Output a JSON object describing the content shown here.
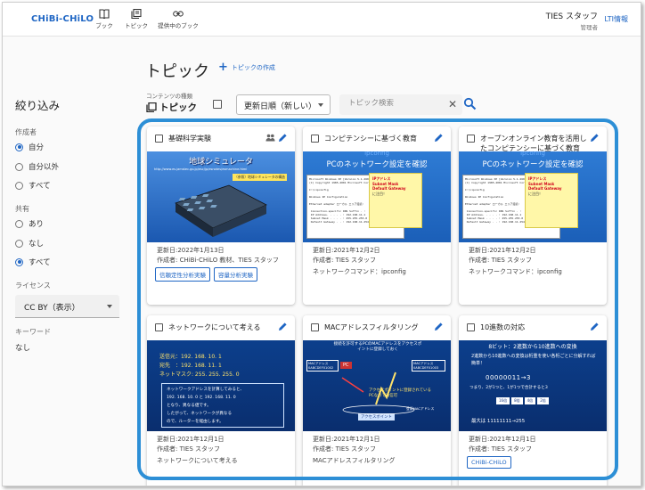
{
  "app": {
    "logo": "CHiBi-CHiLO",
    "nav": [
      {
        "label": "ブック",
        "icon": "book-icon"
      },
      {
        "label": "トピック",
        "icon": "topic-icon"
      },
      {
        "label": "提供中のブック",
        "icon": "link-icon"
      }
    ],
    "user_name": "TIES スタッフ",
    "user_role": "管理者",
    "lti_link": "LTI情報"
  },
  "sidebar": {
    "title": "絞り込み",
    "author_label": "作成者",
    "author_options": [
      "自分",
      "自分以外",
      "すべて"
    ],
    "author_selected": 0,
    "shared_label": "共有",
    "shared_options": [
      "あり",
      "なし",
      "すべて"
    ],
    "shared_selected": 2,
    "license_label": "ライセンス",
    "license_value": "CC BY（表示）",
    "keyword_label": "キーワード",
    "keyword_value": "なし"
  },
  "main": {
    "title": "トピック",
    "add_link": "トピックの作成",
    "content_type_label": "コンテンツの種類",
    "content_type": "トピック",
    "sort_value": "更新日順（新しい）",
    "search_placeholder": "トピック検索"
  },
  "cards": [
    {
      "title": "基礎科学実験",
      "thumb_title": "地球シミュレータ",
      "thumb_url": "http://www.es.jamstec.go.jp/esc/jp/esnotes/esmachine.html",
      "thumb_note": "（参照）地球シミュレータの構造",
      "updated": "更新日:2022年1月13日",
      "author": "作成者: CHiBi-CHiLO 教材、TIES スタッフ",
      "tags": [
        "信頼定性分析実験",
        "容量分析実験"
      ],
      "shared": true
    },
    {
      "title": "コンピテンシーに基づく教育",
      "thumb_title": "PCのネットワーク設定を確認",
      "thumb_over": "ipconfig",
      "updated": "更新日:2021年12月2日",
      "author": "作成者: TIES スタッフ",
      "keyword": "ネットワークコマンド：ipconfig",
      "yellow_red": [
        "IPアドレス",
        "Subnet Mask",
        "Default Gateway"
      ],
      "yellow_text": "に注目！"
    },
    {
      "title": "オープンオンライン教育を活用したコンピテンシーに基づく教育",
      "thumb_title": "PCのネットワーク設定を確認",
      "thumb_over": "ipconfig",
      "updated": "更新日:2021年12月2日",
      "author": "作成者: TIES スタッフ",
      "keyword": "ネットワークコマンド：ipconfig",
      "yellow_red": [
        "IPアドレス",
        "Subnet Mask",
        "Default Gateway"
      ],
      "yellow_text": "に注目！"
    },
    {
      "title": "ネットワークについて考える",
      "thumb_lines": [
        "送信元：192. 168. 10. 1",
        "宛先　：192. 168. 11. 1",
        "ネットマスク: 255. 255. 255. 0"
      ],
      "thumb_box": [
        "ネットワークアドレスを計算してみると、",
        "192. 168. 10. 0 と 192. 168. 11. 0",
        "となり、異なる値です。",
        "したがって、ネットワークが異なる",
        "ので、ルーターを経由します。"
      ],
      "updated": "更新日:2021年12月1日",
      "author": "作成者: TIES スタッフ",
      "keyword": "ネットワークについて考える"
    },
    {
      "title": "MACアドレスフィルタリング",
      "thumb_caption": "接続を許可するPCのMACアドレスをアクセスポイントに登録しておく",
      "thumb_mac1": "MACアドレス 0ABCDEF01002",
      "thumb_mac2": "MACアドレス 0ABCDEF01003",
      "thumb_ap": "アクセスポイントに登録されているPCなので通信可",
      "thumb_reg": "登録MACアドレス",
      "thumb_apl": "アクセスポイント",
      "thumb_pc": "PC",
      "updated": "更新日:2021年12月1日",
      "author": "作成者: TIES スタッフ",
      "keyword": "MACアドレスフィルタリング"
    },
    {
      "title": "10進数の対応",
      "thumb_title": "8ビット：2進数から10進数への変換",
      "thumb_sub": "2進数から10進数への変換は桁重を使い各桁ごとに分解すれば簡単！",
      "thumb_bits": "00000011→3",
      "thumb_calc": "つまり、2が1つと、1が1つで合計すると3",
      "thumb_max": "最大は 11111111→255",
      "updated": "更新日:2021年12月1日",
      "author": "作成者: TIES スタッフ",
      "tags": [
        "CHiBi-CHiLO"
      ]
    }
  ]
}
